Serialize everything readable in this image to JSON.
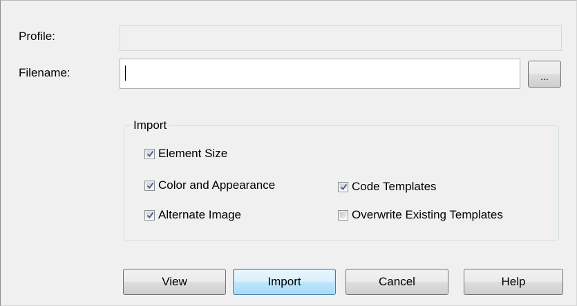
{
  "fields": {
    "profile_label": "Profile:",
    "profile_value": "",
    "filename_label": "Filename:",
    "filename_value": "",
    "browse_label": "..."
  },
  "import_group": {
    "title": "Import",
    "options": {
      "element_size": {
        "label": "Element Size",
        "checked": true
      },
      "color_appearance": {
        "label": "Color and Appearance",
        "checked": true
      },
      "alternate_image": {
        "label": "Alternate Image",
        "checked": true
      },
      "code_templates": {
        "label": "Code Templates",
        "checked": true
      },
      "overwrite_templates": {
        "label": "Overwrite Existing Templates",
        "checked": false
      }
    }
  },
  "buttons": {
    "view": "View",
    "import": "Import",
    "cancel": "Cancel",
    "help": "Help"
  },
  "colors": {
    "dialog_bg": "#f0f0f0",
    "check_mark": "#4a5f97",
    "default_button_border": "#3c7fb1"
  }
}
